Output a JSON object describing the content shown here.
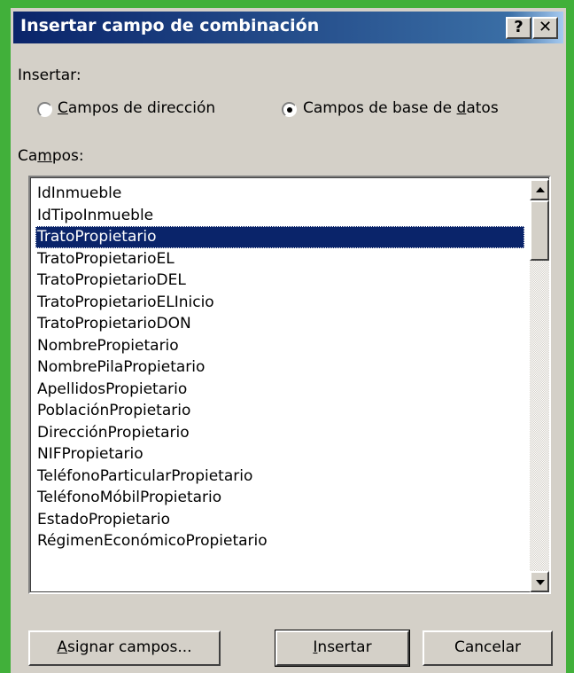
{
  "dialog": {
    "title": "Insertar campo de combinación",
    "help_label": "?",
    "close_label": "✕"
  },
  "insert_group": {
    "label": "Insertar:",
    "options": [
      {
        "prefix": "",
        "accel": "C",
        "rest": "ampos de dirección",
        "selected": false
      },
      {
        "prefix": "Campos de base de ",
        "accel": "d",
        "rest": "atos",
        "selected": true
      }
    ]
  },
  "fields": {
    "label_prefix": "Ca",
    "label_accel": "m",
    "label_rest": "pos:",
    "selected_index": 2,
    "items": [
      "IdInmueble",
      "IdTipoInmueble",
      "TratoPropietario",
      "TratoPropietarioEL",
      "TratoPropietarioDEL",
      "TratoPropietarioELInicio",
      "TratoPropietarioDON",
      "NombrePropietario",
      "NombrePilaPropietario",
      "ApellidosPropietario",
      "PoblaciónPropietario",
      "DirecciónPropietario",
      "NIFPropietario",
      "TeléfonoParticularPropietario",
      "TeléfonoMóbilPropietario",
      "EstadoPropietario",
      "RégimenEconómicoPropietario"
    ]
  },
  "buttons": {
    "assign": {
      "accel": "A",
      "rest": "signar campos..."
    },
    "insert": {
      "accel": "I",
      "rest": "nsertar"
    },
    "cancel": {
      "label": "Cancelar"
    }
  },
  "colors": {
    "frame_green": "#41b03a",
    "title_start": "#0a246a",
    "title_end": "#a6caf0",
    "selection": "#0a246a",
    "face": "#d4d0c8"
  }
}
